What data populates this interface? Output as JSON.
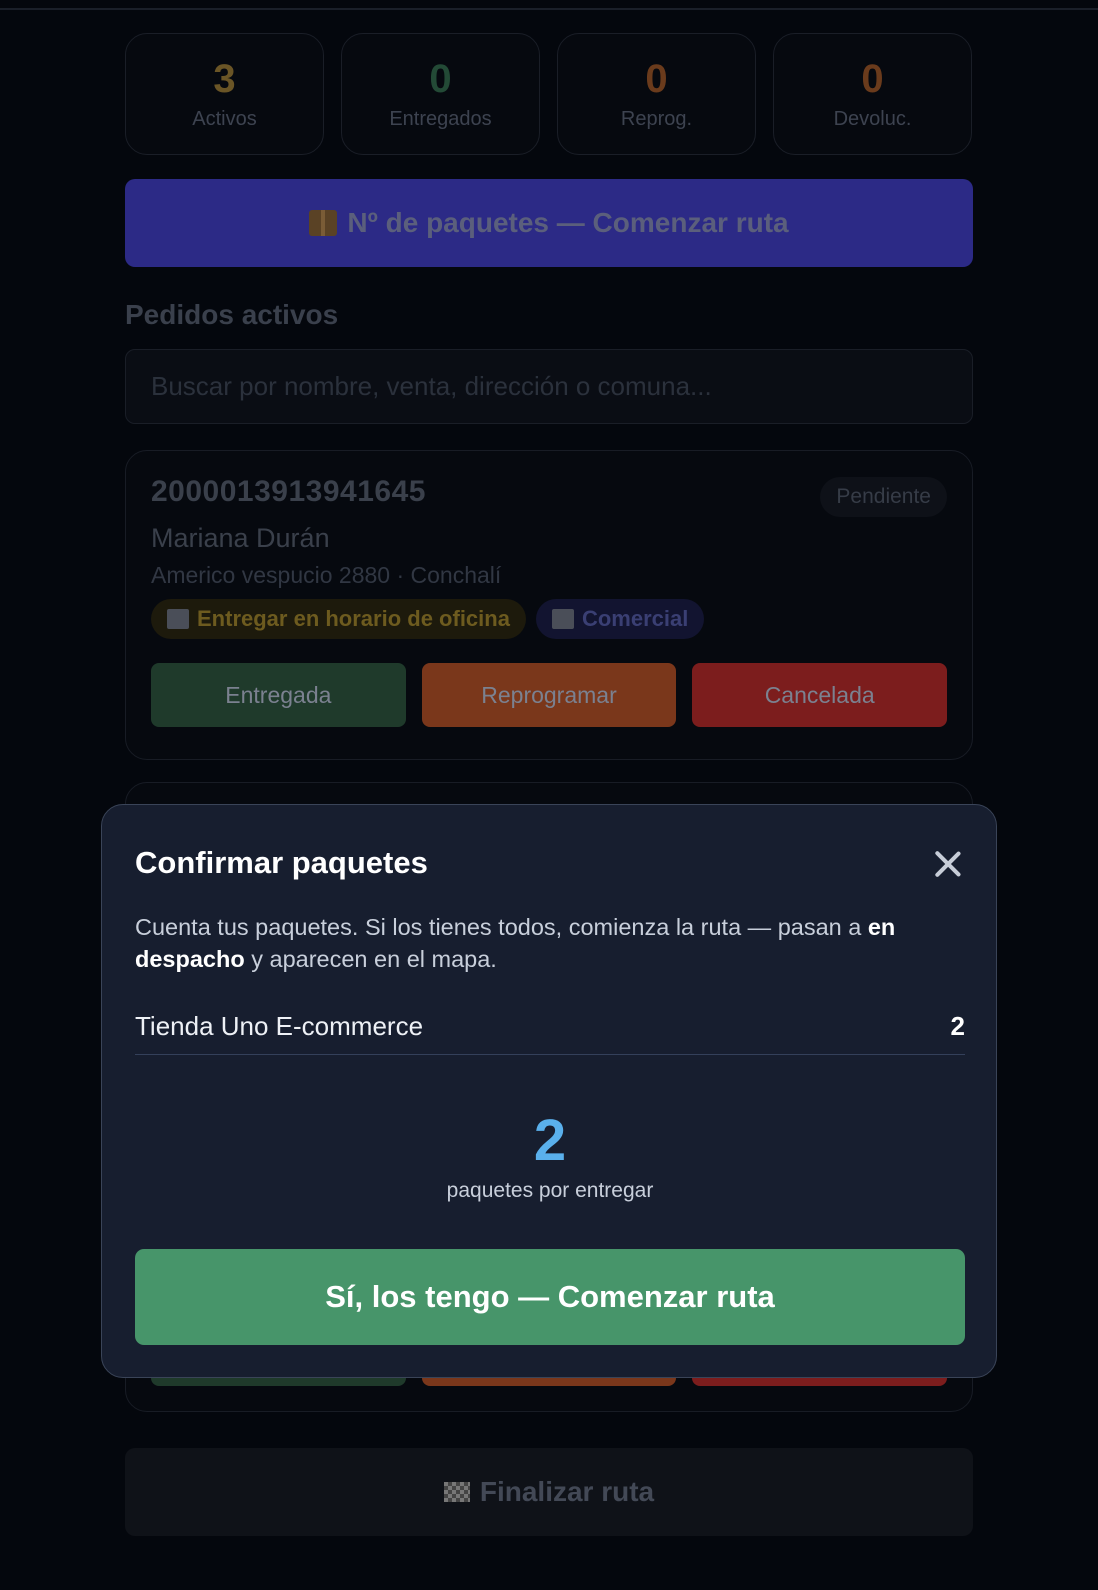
{
  "stats": [
    {
      "value": "3",
      "label": "Activos",
      "color": "#6a5526"
    },
    {
      "value": "0",
      "label": "Entregados",
      "color": "#234a36"
    },
    {
      "value": "0",
      "label": "Reprog.",
      "color": "#6a3b1c"
    },
    {
      "value": "0",
      "label": "Devoluc.",
      "color": "#6a3b1c"
    }
  ],
  "route_button": {
    "label": "Nº de paquetes — Comenzar ruta",
    "icon": "package-icon"
  },
  "section_title": "Pedidos activos",
  "search": {
    "placeholder": "Buscar por nombre, venta, dirección o comuna..."
  },
  "order": {
    "id": "2000013913941645",
    "status": "Pendiente",
    "customer": "Mariana Durán",
    "address": "Americo vespucio 2880 · Conchalí",
    "tags": [
      {
        "label": "Entregar en horario de oficina",
        "icon": "building-icon"
      },
      {
        "label": "Comercial",
        "icon": "building-icon"
      }
    ],
    "actions": {
      "delivered": "Entregada",
      "reschedule": "Reprogramar",
      "cancelled": "Cancelada"
    }
  },
  "finish_button": {
    "label": "Finalizar ruta",
    "icon": "checkered-flag-icon"
  },
  "modal": {
    "title": "Confirmar paquetes",
    "desc_prefix": "Cuenta tus paquetes. Si los tienes todos, comienza la ruta — pasan a ",
    "desc_bold": "en despacho",
    "desc_suffix": " y aparecen en el mapa.",
    "store": {
      "name": "Tienda Uno E-commerce",
      "count": "2"
    },
    "total": "2",
    "total_label": "paquetes por entregar",
    "confirm_label": "Sí, los tengo — Comenzar ruta"
  }
}
